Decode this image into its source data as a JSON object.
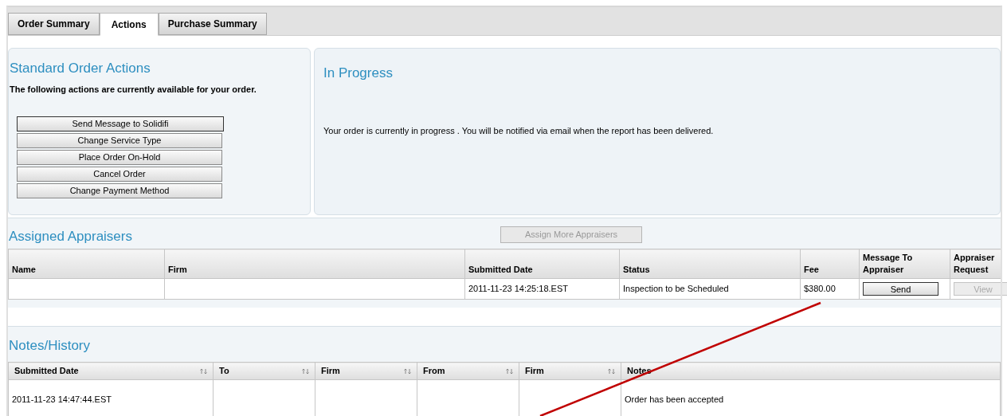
{
  "tabs": [
    {
      "label": "Order Summary",
      "selected": false
    },
    {
      "label": "Actions",
      "selected": true
    },
    {
      "label": "Purchase Summary",
      "selected": false
    }
  ],
  "standard_actions": {
    "title": "Standard Order Actions",
    "intro": "The following actions are currently available for your order.",
    "buttons": [
      {
        "label": "Send Message to Solidifi",
        "focused": true
      },
      {
        "label": "Change Service Type",
        "focused": false
      },
      {
        "label": "Place Order On-Hold",
        "focused": false
      },
      {
        "label": "Cancel Order",
        "focused": false
      },
      {
        "label": "Change Payment Method",
        "focused": false
      }
    ]
  },
  "status_panel": {
    "title": "In Progress",
    "message": "Your order is currently in progress . You will be notified via email when the report has been delivered."
  },
  "assigned_appraisers": {
    "title": "Assigned Appraisers",
    "assign_button": {
      "label": "Assign More Appraisers",
      "disabled": true
    },
    "columns": [
      "Name",
      "Firm",
      "Submitted Date",
      "Status",
      "Fee",
      "Message To Appraiser",
      "Appraiser Request"
    ],
    "rows": [
      {
        "submitted_date": "2011-11-23 14:25:18.EST",
        "status": "Inspection to be Scheduled",
        "fee": "$380.00",
        "message_button": {
          "label": "Send",
          "disabled": false
        },
        "request_button": {
          "label": "View",
          "disabled": true
        }
      }
    ]
  },
  "notes_history": {
    "title": "Notes/History",
    "columns": [
      {
        "label": "Submitted Date",
        "kind": "sortable"
      },
      {
        "label": "To",
        "kind": "sortable"
      },
      {
        "label": "Firm",
        "kind": "sortable"
      },
      {
        "label": "From",
        "kind": "sortable"
      },
      {
        "label": "Firm",
        "kind": "sortable"
      },
      {
        "label": "Notes",
        "kind": "plain"
      }
    ],
    "rows": [
      {
        "submitted_date": "2011-11-23 14:47:44.EST",
        "notes": "Order has been accepted"
      }
    ]
  }
}
